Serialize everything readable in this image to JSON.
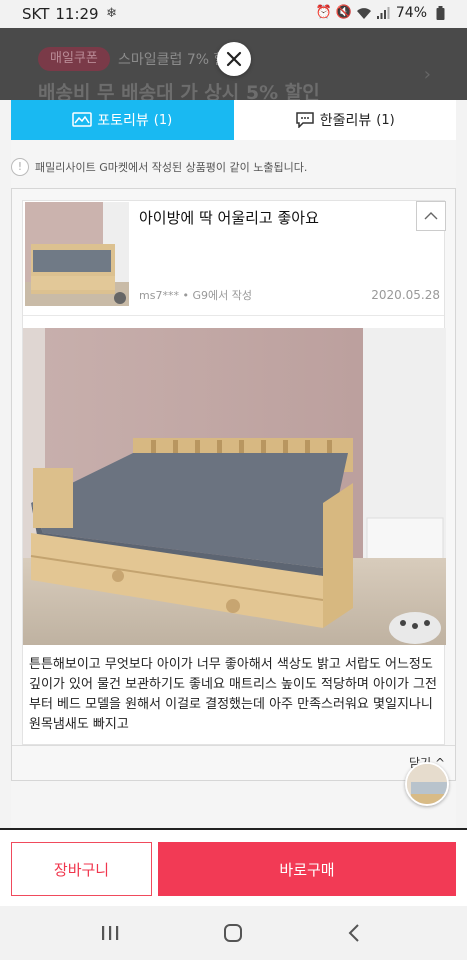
{
  "status": {
    "carrier": "SKT",
    "time": "11:29",
    "battery": "74%"
  },
  "background": {
    "badge": "매일쿠폰",
    "promo": "스마일클럽 7% 할",
    "headline": "배송비 무 배송대 가 상시 5% 할인"
  },
  "tabs": [
    {
      "label": "포토리뷰",
      "count": "(1)"
    },
    {
      "label": "한줄리뷰",
      "count": "(1)"
    }
  ],
  "notice": "패밀리사이트 G마켓에서 작성된 상품평이 같이 노출됩니다.",
  "review": {
    "title": "아이방에 딱 어울리고 좋아요",
    "author": "ms7***",
    "source": "G9에서 작성",
    "date": "2020.05.28",
    "body": "튼튼해보이고 무엇보다 아이가 너무 좋아해서 색상도 밝고 서랍도 어느정도 깊이가 있어 물건 보관하기도 좋네요 매트리스 높이도 적당하며 아이가 그전부터 베드 모델을 원해서 이걸로 결정했는데 아주 만족스러워요 몇일지나니 원목냄새도 빠지고",
    "fold_label": "닫기 ^"
  },
  "bottom": {
    "cart_label": "장바구니",
    "buy_label": "바로구매"
  },
  "colors": {
    "active_tab": "#19b9f2",
    "buy": "#f23a55"
  },
  "icons": {
    "tab_photo": "photo-review-icon",
    "tab_line": "speech-bubble-icon",
    "close": "close-icon"
  }
}
